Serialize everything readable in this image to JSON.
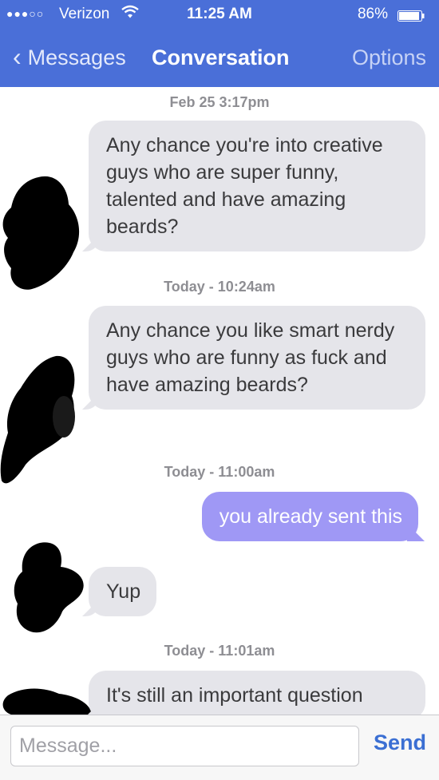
{
  "status": {
    "signal": "●●●○○",
    "carrier": "Verizon",
    "wifi_icon": "wifi-icon",
    "time": "11:25 AM",
    "battery": "86%",
    "battery_icon": "battery-icon"
  },
  "nav": {
    "back_icon": "chevron-left-icon",
    "back_label": "Messages",
    "title": "Conversation",
    "options_label": "Options"
  },
  "conversation": {
    "stamps": [
      "Feb 25 3:17pm",
      "Today - 10:24am",
      "Today - 11:00am",
      "Today - 11:01am"
    ],
    "messages": [
      {
        "direction": "in",
        "text": "Any chance you're into creative guys who are super funny, talented and have amazing beards?"
      },
      {
        "direction": "in",
        "text": "Any chance you like smart nerdy guys who are funny as fuck and have amazing beards?"
      },
      {
        "direction": "out",
        "text": "you already sent this"
      },
      {
        "direction": "in",
        "text": "Yup"
      },
      {
        "direction": "in",
        "text": "It's still an important question"
      }
    ]
  },
  "composer": {
    "placeholder": "Message...",
    "send_label": "Send"
  },
  "colors": {
    "header": "#4a6fd8",
    "incoming_bubble": "#e5e5ea",
    "outgoing_bubble": "#9f98f5",
    "send": "#3b6fd3"
  }
}
